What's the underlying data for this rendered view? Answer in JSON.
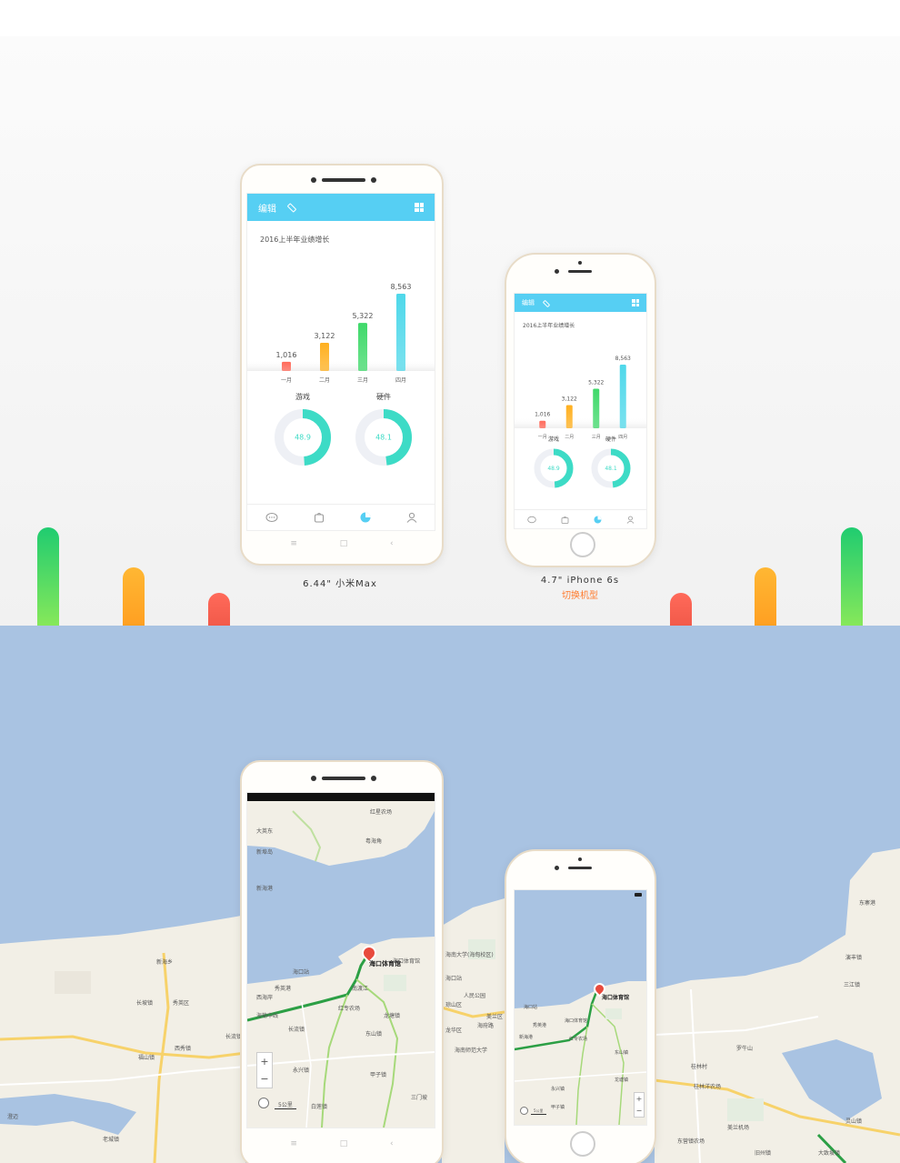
{
  "colors": {
    "accent": "#56cff3",
    "bar_red": "#ff6a5a",
    "bar_orange": "#ffb020",
    "bar_green": "#3fd96a",
    "bar_cyan": "#4fd8ea",
    "donut_teal": "#3ddbc6",
    "caption_link": "#ff7b2e",
    "map_water": "#a9c3e2",
    "map_land": "#f2efe6"
  },
  "app": {
    "edit_label": "编辑",
    "chart_title": "2016上半年业绩增长",
    "donuts": [
      {
        "label": "游戏",
        "value_text": "48.9",
        "percent": 48.9
      },
      {
        "label": "硬件",
        "value_text": "48.1",
        "percent": 48.1
      }
    ],
    "tabs": [
      "chat-icon",
      "bag-icon",
      "pie-chart-icon",
      "profile-icon"
    ],
    "nav_symbols": [
      "≡",
      "□",
      "‹"
    ]
  },
  "chart_data": {
    "type": "bar",
    "title": "2016上半年业绩增长",
    "categories": [
      "一月",
      "二月",
      "三月",
      "四月"
    ],
    "values": [
      1016,
      3122,
      5322,
      8563
    ],
    "value_labels": [
      "1,016",
      "3,122",
      "5,322",
      "8,563"
    ],
    "xlabel": "",
    "ylabel": "",
    "grid": false
  },
  "captions": {
    "max": "6.44\" 小米Max",
    "iphone": "4.7\" iPhone 6s",
    "switch_link": "切换机型"
  },
  "map": {
    "pin_label": "海口体育馆",
    "scale_label": "5公里",
    "labels": {
      "bg": [
        "新海乡",
        "西秀镇",
        "长流镇",
        "海南大学(海甸校区)",
        "人民公园",
        "琼山区",
        "海南师范大学",
        "东营镇农场",
        "桂林洋农场",
        "美兰机场",
        "演丰镇",
        "三江镇",
        "东寨港",
        "海口站",
        "秀英区",
        "龙华区",
        "美兰区",
        "大致坡镇",
        "旧州镇",
        "老城镇",
        "澄迈",
        "海府路",
        "长坡镇",
        "罗牛山",
        "灵山镇",
        "桂林村",
        "福山镇"
      ],
      "max": [
        "红星农场",
        "大英东",
        "新埠岛",
        "粤海角",
        "海口站",
        "海口体育馆",
        "红专农场",
        "东山镇",
        "龙塘镇",
        "三门坡",
        "秀英港",
        "永兴镇",
        "白莲镇",
        "甲子镇",
        "长流镇",
        "海榆中线",
        "南渡江",
        "西海岸",
        "新海港"
      ],
      "ip": [
        "海口站",
        "海口体育馆",
        "永兴镇",
        "红专农场",
        "东山镇",
        "龙塘镇",
        "秀英港",
        "甲子镇",
        "新海港"
      ]
    }
  }
}
